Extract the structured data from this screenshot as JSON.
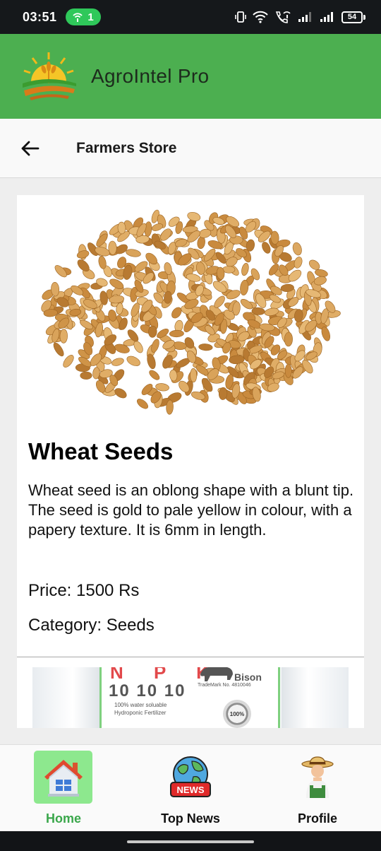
{
  "status_bar": {
    "time": "03:51",
    "hotspot_count": "1",
    "battery": "54"
  },
  "app": {
    "title": "AgroIntel Pro",
    "header_color": "#4caf50"
  },
  "sub_header": {
    "title": "Farmers Store",
    "back_icon": "arrow-left-icon"
  },
  "products": [
    {
      "name": "Wheat Seeds",
      "description": "Wheat seed is an oblong shape with a blunt tip. The seed is gold to pale yellow in colour, with a papery texture. It is 6mm in length.",
      "price": "Price: 1500 Rs",
      "category": "Category: Seeds"
    },
    {
      "image_text": {
        "npk": "N P K",
        "ratio": "10 10 10",
        "note": "100% water soluable Hydroponic Fertilizer",
        "brand": "Bison",
        "trademark": "TradeMark No. 4810046",
        "seal": "100%"
      }
    }
  ],
  "bottom_nav": {
    "items": [
      {
        "label": "Home",
        "icon": "house-icon",
        "active": true
      },
      {
        "label": "Top News",
        "icon": "news-globe-icon",
        "active": false
      },
      {
        "label": "Profile",
        "icon": "farmer-icon",
        "active": false
      }
    ],
    "news_badge": "NEWS",
    "active_color": "#3aa74b"
  }
}
